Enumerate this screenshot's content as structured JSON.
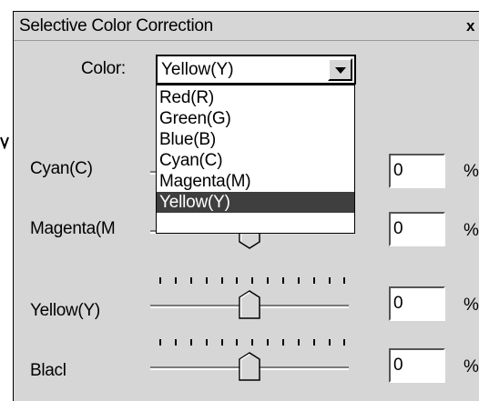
{
  "dialog": {
    "title": "Selective Color Correction",
    "close_label": "x"
  },
  "color": {
    "label": "Color:",
    "selected": "Yellow(Y)",
    "options": [
      "Red(R)",
      "Green(G)",
      "Blue(B)",
      "Cyan(C)",
      "Magenta(M)",
      "Yellow(Y)"
    ],
    "selected_index": 5
  },
  "channels": [
    {
      "label": "Cyan(C)",
      "value": "0",
      "unit": "%",
      "level": 0
    },
    {
      "label": "Magenta(M",
      "value": "0",
      "unit": "%",
      "level": 0
    },
    {
      "label": "Yellow(Y)",
      "value": "0",
      "unit": "%",
      "level": 0
    },
    {
      "label": "Blacl",
      "value": "0",
      "unit": "%",
      "level": 0
    }
  ],
  "colors": {
    "dialog_bg": "#d6d6d6",
    "selection_bg": "#3f3f3f"
  }
}
